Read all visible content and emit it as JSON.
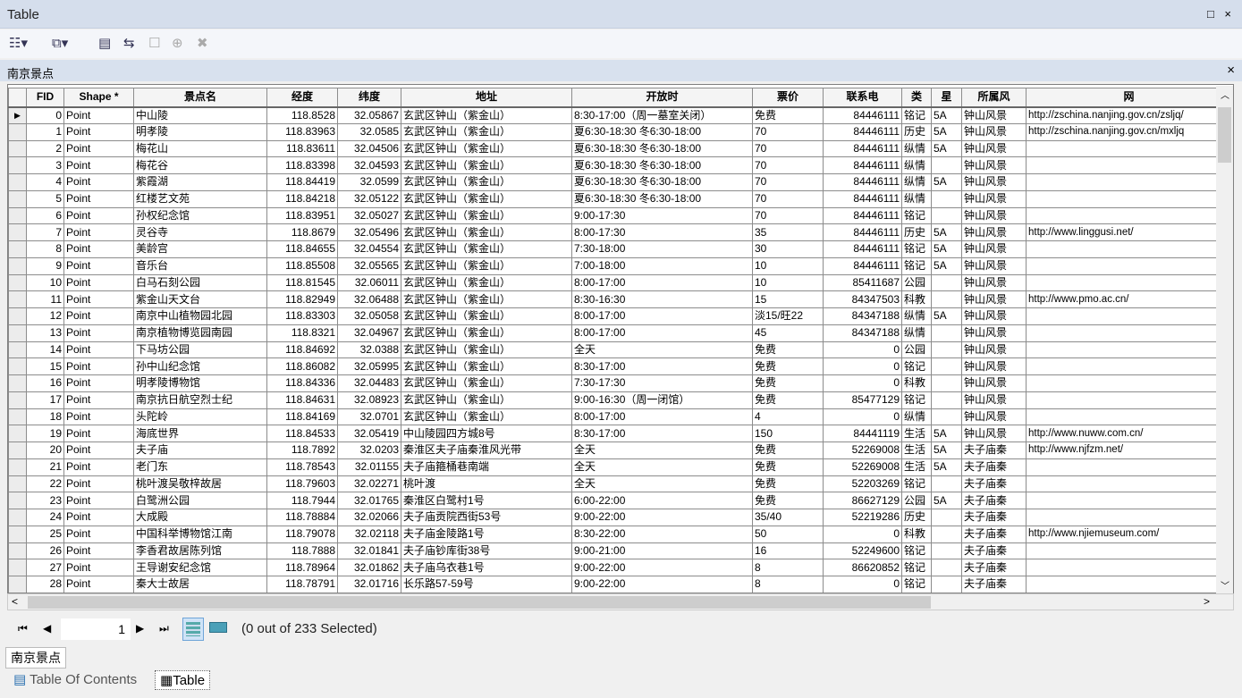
{
  "window": {
    "title": "Table",
    "controls": "□ ×"
  },
  "toolbar": {
    "table_options": "☷▾",
    "related_tables": "⧉▾",
    "select_by_attributes": "▤",
    "switch_selection": "⇆",
    "clear_selection": "☐",
    "zoom_selected": "⊕",
    "delete_selected": "✖"
  },
  "layer": {
    "name": "南京景点",
    "close": "×"
  },
  "columns": [
    "FID",
    "Shape *",
    "景点名",
    "经度",
    "纬度",
    "地址",
    "开放时",
    "票价",
    "联系电",
    "类",
    "星",
    "所属风",
    "网"
  ],
  "rows": [
    [
      "0",
      "Point",
      "中山陵",
      "118.8528",
      "32.05867",
      "玄武区钟山（紫金山）",
      "8:30-17:00（周一墓室关闭）",
      "免费",
      "84446111",
      "铭记",
      "5A",
      "钟山风景",
      "http://zschina.nanjing.gov.cn/zsljq/"
    ],
    [
      "1",
      "Point",
      "明孝陵",
      "118.83963",
      "32.0585",
      "玄武区钟山（紫金山）",
      "夏6:30-18:30 冬6:30-18:00",
      "70",
      "84446111",
      "历史",
      "5A",
      "钟山风景",
      "http://zschina.nanjing.gov.cn/mxljq"
    ],
    [
      "2",
      "Point",
      "梅花山",
      "118.83611",
      "32.04506",
      "玄武区钟山（紫金山）",
      "夏6:30-18:30 冬6:30-18:00",
      "70",
      "84446111",
      "纵情",
      "5A",
      "钟山风景",
      ""
    ],
    [
      "3",
      "Point",
      "梅花谷",
      "118.83398",
      "32.04593",
      "玄武区钟山（紫金山）",
      "夏6:30-18:30 冬6:30-18:00",
      "70",
      "84446111",
      "纵情",
      "",
      "钟山风景",
      ""
    ],
    [
      "4",
      "Point",
      "紫霞湖",
      "118.84419",
      "32.0599",
      "玄武区钟山（紫金山）",
      "夏6:30-18:30 冬6:30-18:00",
      "70",
      "84446111",
      "纵情",
      "5A",
      "钟山风景",
      ""
    ],
    [
      "5",
      "Point",
      "红楼艺文苑",
      "118.84218",
      "32.05122",
      "玄武区钟山（紫金山）",
      "夏6:30-18:30 冬6:30-18:00",
      "70",
      "84446111",
      "纵情",
      "",
      "钟山风景",
      ""
    ],
    [
      "6",
      "Point",
      "孙权纪念馆",
      "118.83951",
      "32.05027",
      "玄武区钟山（紫金山）",
      "9:00-17:30",
      "70",
      "84446111",
      "铭记",
      "",
      "钟山风景",
      ""
    ],
    [
      "7",
      "Point",
      "灵谷寺",
      "118.8679",
      "32.05496",
      "玄武区钟山（紫金山）",
      "8:00-17:30",
      "35",
      "84446111",
      "历史",
      "5A",
      "钟山风景",
      "http://www.linggusi.net/"
    ],
    [
      "8",
      "Point",
      "美龄宫",
      "118.84655",
      "32.04554",
      "玄武区钟山（紫金山）",
      "7:30-18:00",
      "30",
      "84446111",
      "铭记",
      "5A",
      "钟山风景",
      ""
    ],
    [
      "9",
      "Point",
      "音乐台",
      "118.85508",
      "32.05565",
      "玄武区钟山（紫金山）",
      "7:00-18:00",
      "10",
      "84446111",
      "铭记",
      "5A",
      "钟山风景",
      ""
    ],
    [
      "10",
      "Point",
      "白马石刻公园",
      "118.81545",
      "32.06011",
      "玄武区钟山（紫金山）",
      "8:00-17:00",
      "10",
      "85411687",
      "公园",
      "",
      "钟山风景",
      ""
    ],
    [
      "11",
      "Point",
      "紫金山天文台",
      "118.82949",
      "32.06488",
      "玄武区钟山（紫金山）",
      "8:30-16:30",
      "15",
      "84347503",
      "科教",
      "",
      "钟山风景",
      "http://www.pmo.ac.cn/"
    ],
    [
      "12",
      "Point",
      "南京中山植物园北园",
      "118.83303",
      "32.05058",
      "玄武区钟山（紫金山）",
      "8:00-17:00",
      "淡15/旺22",
      "84347188",
      "纵情",
      "5A",
      "钟山风景",
      ""
    ],
    [
      "13",
      "Point",
      "南京植物博览园南园",
      "118.8321",
      "32.04967",
      "玄武区钟山（紫金山）",
      "8:00-17:00",
      "45",
      "84347188",
      "纵情",
      "",
      "钟山风景",
      ""
    ],
    [
      "14",
      "Point",
      "下马坊公园",
      "118.84692",
      "32.0388",
      "玄武区钟山（紫金山）",
      "全天",
      "免费",
      "0",
      "公园",
      "",
      "钟山风景",
      ""
    ],
    [
      "15",
      "Point",
      "孙中山纪念馆",
      "118.86082",
      "32.05995",
      "玄武区钟山（紫金山）",
      "8:30-17:00",
      "免费",
      "0",
      "铭记",
      "",
      "钟山风景",
      ""
    ],
    [
      "16",
      "Point",
      "明孝陵博物馆",
      "118.84336",
      "32.04483",
      "玄武区钟山（紫金山）",
      "7:30-17:30",
      "免费",
      "0",
      "科教",
      "",
      "钟山风景",
      ""
    ],
    [
      "17",
      "Point",
      "南京抗日航空烈士纪",
      "118.84631",
      "32.08923",
      "玄武区钟山（紫金山）",
      "9:00-16:30（周一闭馆）",
      "免费",
      "85477129",
      "铭记",
      "",
      "钟山风景",
      ""
    ],
    [
      "18",
      "Point",
      "头陀岭",
      "118.84169",
      "32.0701",
      "玄武区钟山（紫金山）",
      "8:00-17:00",
      "4",
      "0",
      "纵情",
      "",
      "钟山风景",
      ""
    ],
    [
      "19",
      "Point",
      "海底世界",
      "118.84533",
      "32.05419",
      "中山陵园四方城8号",
      "8:30-17:00",
      "150",
      "84441119",
      "生活",
      "5A",
      "钟山风景",
      "http://www.nuww.com.cn/"
    ],
    [
      "20",
      "Point",
      "夫子庙",
      "118.7892",
      "32.0203",
      "秦淮区夫子庙秦淮风光带",
      "全天",
      "免费",
      "52269008",
      "生活",
      "5A",
      "夫子庙秦",
      "http://www.njfzm.net/"
    ],
    [
      "21",
      "Point",
      "老门东",
      "118.78543",
      "32.01155",
      "夫子庙箍桶巷南端",
      "全天",
      "免费",
      "52269008",
      "生活",
      "5A",
      "夫子庙秦",
      ""
    ],
    [
      "22",
      "Point",
      "桃叶渡吴敬梓故居",
      "118.79603",
      "32.02271",
      "桃叶渡",
      "全天",
      "免费",
      "52203269",
      "铭记",
      "",
      "夫子庙秦",
      ""
    ],
    [
      "23",
      "Point",
      "白鹭洲公园",
      "118.7944",
      "32.01765",
      "秦淮区白鹭村1号",
      "6:00-22:00",
      "免费",
      "86627129",
      "公园",
      "5A",
      "夫子庙秦",
      ""
    ],
    [
      "24",
      "Point",
      "大成殿",
      "118.78884",
      "32.02066",
      "夫子庙贡院西街53号",
      "9:00-22:00",
      "35/40",
      "52219286",
      "历史",
      "",
      "夫子庙秦",
      ""
    ],
    [
      "25",
      "Point",
      "中国科举博物馆江南",
      "118.79078",
      "32.02118",
      "夫子庙金陵路1号",
      "8:30-22:00",
      "50",
      "0",
      "科教",
      "",
      "夫子庙秦",
      "http://www.njiemuseum.com/"
    ],
    [
      "26",
      "Point",
      "李香君故居陈列馆",
      "118.7888",
      "32.01841",
      "夫子庙钞库街38号",
      "9:00-21:00",
      "16",
      "52249600",
      "铭记",
      "",
      "夫子庙秦",
      ""
    ],
    [
      "27",
      "Point",
      "王导谢安纪念馆",
      "118.78964",
      "32.01862",
      "夫子庙乌衣巷1号",
      "9:00-22:00",
      "8",
      "86620852",
      "铭记",
      "",
      "夫子庙秦",
      ""
    ],
    [
      "28",
      "Point",
      "秦大士故居",
      "118.78791",
      "32.01716",
      "长乐路57-59号",
      "9:00-22:00",
      "8",
      "0",
      "铭记",
      "",
      "夫子庙秦",
      ""
    ]
  ],
  "navigation": {
    "first": "⏮",
    "prev": "◀",
    "page": "1",
    "next": "▶",
    "last": "⏭",
    "status": "(0 out of 233 Selected)"
  },
  "bottom_tabs": {
    "layer_tab": "南京景点",
    "toc": "Table Of Contents",
    "table": "Table"
  }
}
